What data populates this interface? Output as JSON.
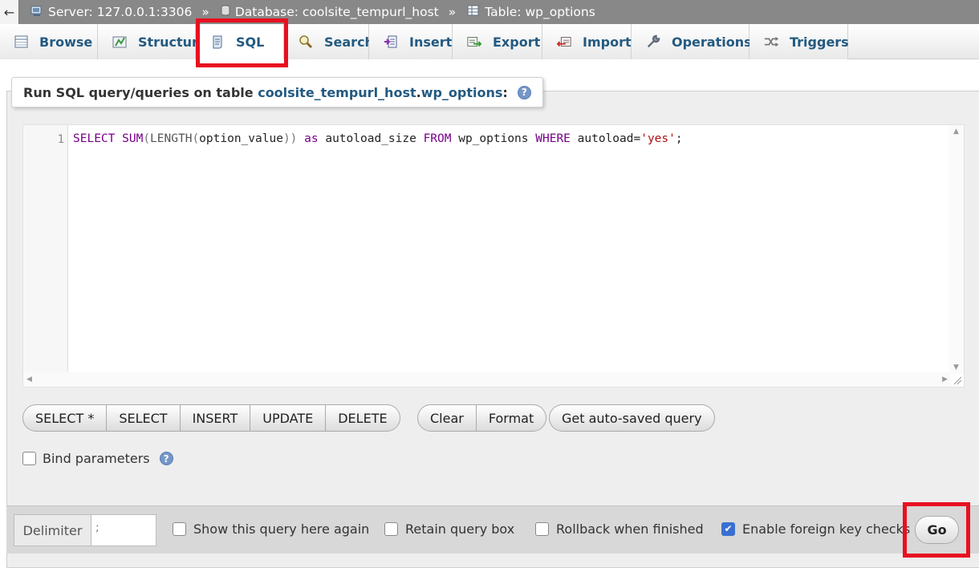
{
  "breadcrumb": {
    "back_label": "←",
    "server": "Server: 127.0.0.1:3306",
    "database": "Database: coolsite_tempurl_host",
    "table": "Table: wp_options",
    "separator": "»"
  },
  "tabs": [
    {
      "label": "Browse",
      "icon": "browse-icon"
    },
    {
      "label": "Structure",
      "icon": "structure-icon"
    },
    {
      "label": "SQL",
      "icon": "sql-icon",
      "active": true
    },
    {
      "label": "Search",
      "icon": "search-icon"
    },
    {
      "label": "Insert",
      "icon": "insert-icon"
    },
    {
      "label": "Export",
      "icon": "export-icon"
    },
    {
      "label": "Import",
      "icon": "import-icon"
    },
    {
      "label": "Operations",
      "icon": "wrench-icon"
    },
    {
      "label": "Triggers",
      "icon": "triggers-icon"
    }
  ],
  "panel": {
    "legend_prefix": "Run SQL query/queries on table ",
    "legend_db": "coolsite_tempurl_host",
    "legend_dot": ".",
    "legend_table": "wp_options",
    "legend_suffix": ":"
  },
  "editor": {
    "line_number": "1",
    "query": {
      "t1": "SELECT",
      "t2": " SUM",
      "t3": "(",
      "t4": "LENGTH",
      "t5": "(",
      "t6": "option_value",
      "t7": "))",
      "t8": " as",
      "t9": " autoload_size ",
      "t10": "FROM",
      "t11": " wp_options ",
      "t12": "WHERE",
      "t13": " autoload=",
      "t14": "'yes'",
      "t15": ";"
    }
  },
  "buttons": {
    "snippets": [
      "SELECT *",
      "SELECT",
      "INSERT",
      "UPDATE",
      "DELETE"
    ],
    "edit": [
      "Clear",
      "Format"
    ],
    "autosave": "Get auto-saved query"
  },
  "bind_parameters": {
    "label": "Bind parameters",
    "checked": false
  },
  "help_symbol": "?",
  "footer": {
    "delimiter_label": "Delimiter",
    "delimiter_value": ";",
    "options": [
      {
        "label": "Show this query here again",
        "checked": false
      },
      {
        "label": "Retain query box",
        "checked": false
      },
      {
        "label": "Rollback when finished",
        "checked": false
      },
      {
        "label": "Enable foreign key checks",
        "checked": true
      }
    ],
    "go_label": "Go",
    "check_mark": "✔"
  },
  "colors": {
    "link": "#235a81",
    "highlight": "#e8101f",
    "keyword": "#770088",
    "string": "#aa1111",
    "checked": "#3a6fd1"
  }
}
